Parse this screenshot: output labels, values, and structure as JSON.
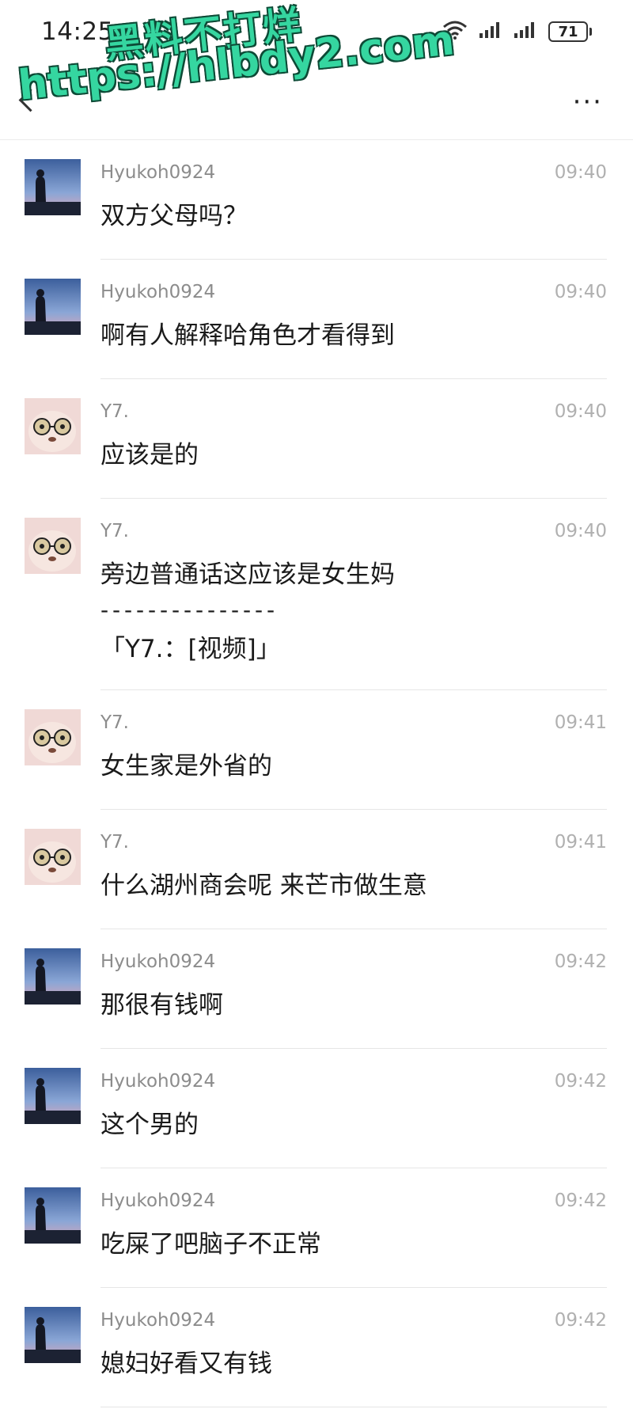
{
  "status_bar": {
    "time": "14:25",
    "battery": "71",
    "icons": [
      "wifi-icon",
      "signal-icon",
      "signal-icon",
      "battery-icon"
    ]
  },
  "watermark": {
    "line1": "黑料不打烊",
    "line2": "https://hlbdy2.com"
  },
  "nav": {
    "more_label": "···"
  },
  "messages": [
    {
      "sender": "Hyukoh0924",
      "time": "09:40",
      "text": "双方父母吗？",
      "avatar": "landscape"
    },
    {
      "sender": "Hyukoh0924",
      "time": "09:40",
      "text": "啊有人解释哈角色才看得到",
      "avatar": "landscape"
    },
    {
      "sender": "Y7.",
      "time": "09:40",
      "text": "应该是的",
      "avatar": "plush"
    },
    {
      "sender": "Y7.",
      "time": "09:40",
      "text": "旁边普通话这应该是女生妈",
      "avatar": "plush",
      "quote_separator": "- - - - - - - - - - - - - - -",
      "quote": "「Y7.：[视频]」"
    },
    {
      "sender": "Y7.",
      "time": "09:41",
      "text": "女生家是外省的",
      "avatar": "plush"
    },
    {
      "sender": "Y7.",
      "time": "09:41",
      "text": "什么湖州商会呢 来芒市做生意",
      "avatar": "plush"
    },
    {
      "sender": "Hyukoh0924",
      "time": "09:42",
      "text": "那很有钱啊",
      "avatar": "landscape"
    },
    {
      "sender": "Hyukoh0924",
      "time": "09:42",
      "text": "这个男的",
      "avatar": "landscape"
    },
    {
      "sender": "Hyukoh0924",
      "time": "09:42",
      "text": "吃屎了吧脑子不正常",
      "avatar": "landscape"
    },
    {
      "sender": "Hyukoh0924",
      "time": "09:42",
      "text": "媳妇好看又有钱",
      "avatar": "landscape"
    }
  ]
}
